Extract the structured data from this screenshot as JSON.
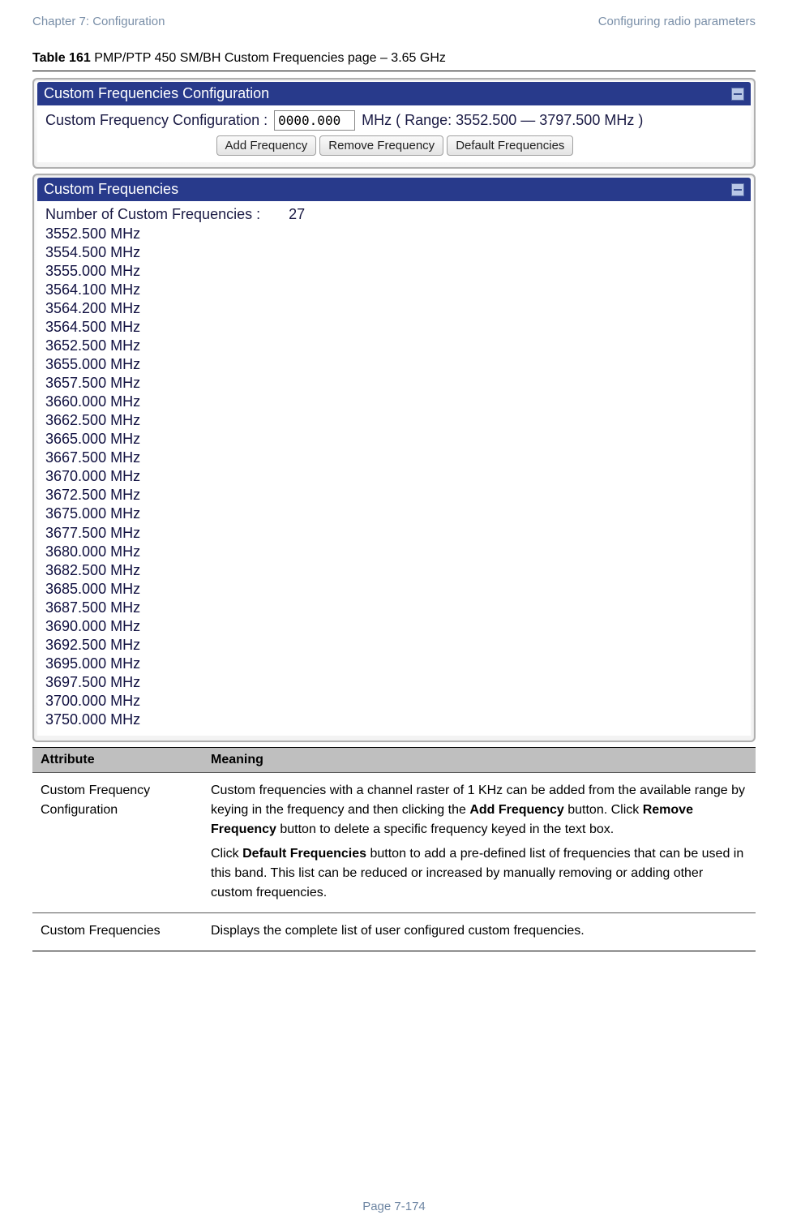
{
  "header": {
    "left": "Chapter 7:  Configuration",
    "right": "Configuring radio parameters"
  },
  "caption": {
    "prefix": "Table 161",
    "rest": " PMP/PTP 450 SM/BH Custom Frequencies page – 3.65 GHz"
  },
  "config_panel": {
    "title": "Custom Frequencies Configuration",
    "label": "Custom Frequency Configuration :",
    "input_value": "0000.000",
    "range_text": "MHz (  Range: 3552.500 — 3797.500 MHz )",
    "buttons": {
      "add": "Add Frequency",
      "remove": "Remove Frequency",
      "default": "Default Frequencies"
    }
  },
  "list_panel": {
    "title": "Custom Frequencies",
    "count_label": "Number of Custom Frequencies :",
    "count_value": "27",
    "frequencies": [
      "3552.500 MHz",
      "3554.500 MHz",
      "3555.000 MHz",
      "3564.100 MHz",
      "3564.200 MHz",
      "3564.500 MHz",
      "3652.500 MHz",
      "3655.000 MHz",
      "3657.500 MHz",
      "3660.000 MHz",
      "3662.500 MHz",
      "3665.000 MHz",
      "3667.500 MHz",
      "3670.000 MHz",
      "3672.500 MHz",
      "3675.000 MHz",
      "3677.500 MHz",
      "3680.000 MHz",
      "3682.500 MHz",
      "3685.000 MHz",
      "3687.500 MHz",
      "3690.000 MHz",
      "3692.500 MHz",
      "3695.000 MHz",
      "3697.500 MHz",
      "3700.000 MHz",
      "3750.000 MHz"
    ]
  },
  "desc_table": {
    "headers": {
      "attr": "Attribute",
      "meaning": "Meaning"
    },
    "rows": [
      {
        "attr": "Custom Frequency Configuration",
        "meaning_parts": {
          "p1a": "Custom frequencies with a channel raster of 1 KHz can be added from the available range by keying in the frequency and then clicking the ",
          "p1b_bold": "Add Frequency",
          "p1c": " button. Click ",
          "p1d_bold": "Remove Frequency",
          "p1e": " button to delete a specific frequency keyed in the text box.",
          "p2a": "Click ",
          "p2b_bold": "Default Frequencies",
          "p2c": " button to add a pre-defined list of frequencies that can be used in this band. This list can be reduced or increased by manually removing or adding other custom frequencies."
        }
      },
      {
        "attr": "Custom Frequencies",
        "meaning_plain": "Displays the complete list of user configured custom frequencies."
      }
    ]
  },
  "footer": "Page 7-174"
}
